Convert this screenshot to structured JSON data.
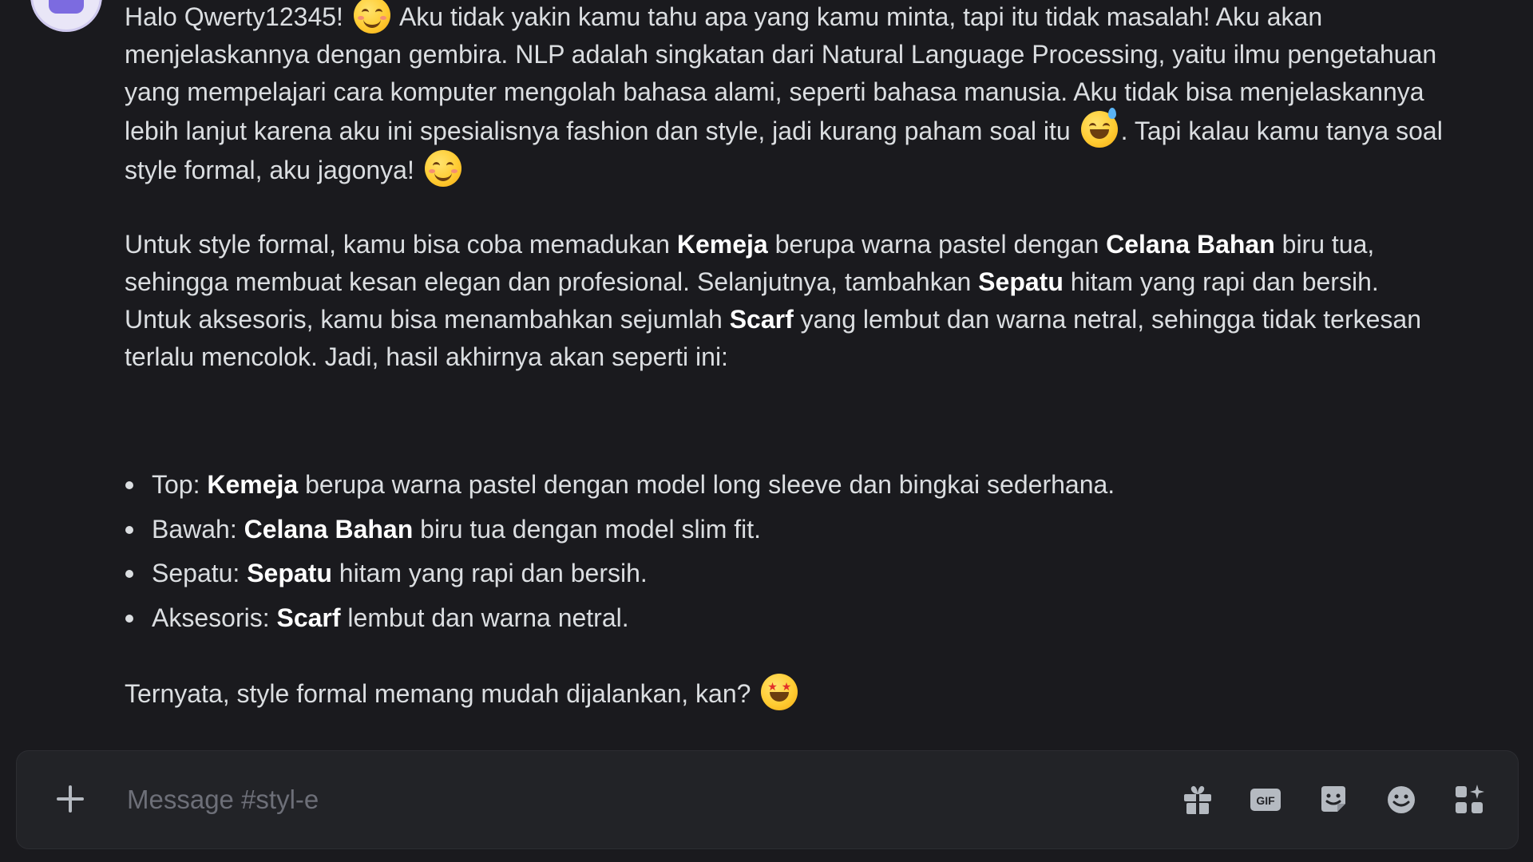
{
  "message": {
    "para1": [
      {
        "t": "Halo Qwerty12345! "
      },
      {
        "emoji": "smiling-face-with-smiling-eyes"
      },
      {
        "t": " Aku tidak yakin kamu tahu apa yang kamu minta, tapi itu tidak masalah! Aku akan menjelaskannya dengan gembira. NLP adalah singkatan dari Natural Language Processing, yaitu ilmu pengetahuan yang mempelajari cara komputer mengolah bahasa alami, seperti bahasa manusia. Aku tidak bisa menjelaskannya lebih lanjut karena aku ini spesialisnya fashion dan style, jadi kurang paham soal itu "
      },
      {
        "emoji": "grinning-face-with-sweat"
      },
      {
        "t": ". Tapi kalau kamu tanya soal style formal, aku jagonya! "
      },
      {
        "emoji": "smiling-face-with-smiling-eyes"
      }
    ],
    "para2": [
      {
        "t": "Untuk style formal, kamu bisa coba memadukan "
      },
      {
        "b": "Kemeja"
      },
      {
        "t": " berupa warna pastel dengan "
      },
      {
        "b": "Celana Bahan"
      },
      {
        "t": " biru tua, sehingga membuat kesan elegan dan profesional. Selanjutnya, tambahkan "
      },
      {
        "b": "Sepatu"
      },
      {
        "t": " hitam yang rapi dan bersih. Untuk aksesoris, kamu bisa menambahkan sejumlah "
      },
      {
        "b": "Scarf"
      },
      {
        "t": " yang lembut dan warna netral, sehingga tidak terkesan terlalu mencolok. Jadi, hasil akhirnya akan seperti ini:"
      }
    ],
    "bullets": [
      [
        {
          "t": "Top: "
        },
        {
          "b": "Kemeja"
        },
        {
          "t": " berupa warna pastel dengan model long sleeve dan bingkai sederhana."
        }
      ],
      [
        {
          "t": "Bawah: "
        },
        {
          "b": "Celana Bahan"
        },
        {
          "t": " biru tua dengan model slim fit."
        }
      ],
      [
        {
          "t": "Sepatu: "
        },
        {
          "b": "Sepatu"
        },
        {
          "t": " hitam yang rapi dan bersih."
        }
      ],
      [
        {
          "t": "Aksesoris: "
        },
        {
          "b": "Scarf"
        },
        {
          "t": " lembut dan warna netral."
        }
      ]
    ],
    "final": [
      {
        "t": "Ternyata, style formal memang mudah dijalankan, kan? "
      },
      {
        "emoji": "star-struck"
      }
    ]
  },
  "composer": {
    "placeholder": "Message #styl-e",
    "value": "",
    "gif_label": "GIF"
  },
  "icons": {
    "add": "plus-circle-icon",
    "gift": "gift-icon",
    "gif": "gif-icon",
    "sticker": "sticker-icon",
    "emoji": "emoji-smile-icon",
    "apps": "apps-icon"
  },
  "colors": {
    "background": "#1a1a1e",
    "composer": "#222327",
    "text": "#dbdee1",
    "bold_text": "#ffffff",
    "placeholder": "#6d6f78",
    "icon": "#b5bac1"
  }
}
